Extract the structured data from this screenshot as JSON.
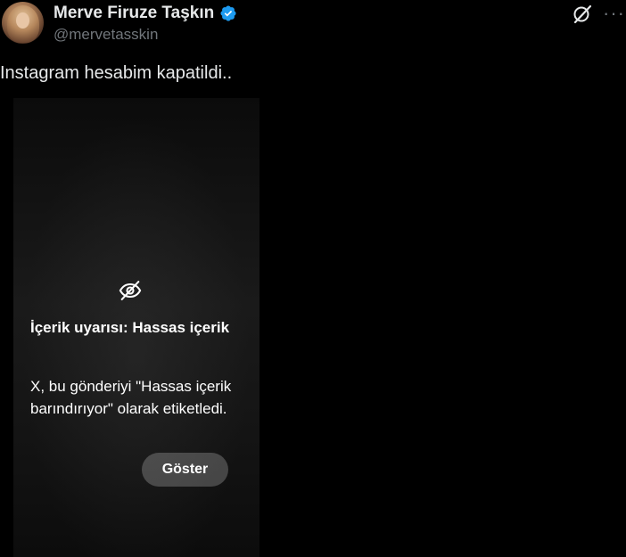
{
  "author": {
    "display_name": "Merve Firuze Taşkın",
    "handle": "@mervetasskin",
    "verified": true
  },
  "post": {
    "text": "Instagram hesabim kapatildi.."
  },
  "sensitive_media": {
    "title": "İçerik uyarısı: Hassas içerik",
    "description": "X, bu gönderiyi \"Hassas içerik barındırıyor\" olarak etiketledi.",
    "show_button_label": "Göster"
  },
  "header_actions": {
    "grok_icon": "grok-icon",
    "more_icon": "more-horizontal-icon",
    "more_label": "···"
  },
  "colors": {
    "background": "#000000",
    "text_primary": "#e7e9ea",
    "text_secondary": "#71767b",
    "verified_blue": "#1d9bf0"
  }
}
